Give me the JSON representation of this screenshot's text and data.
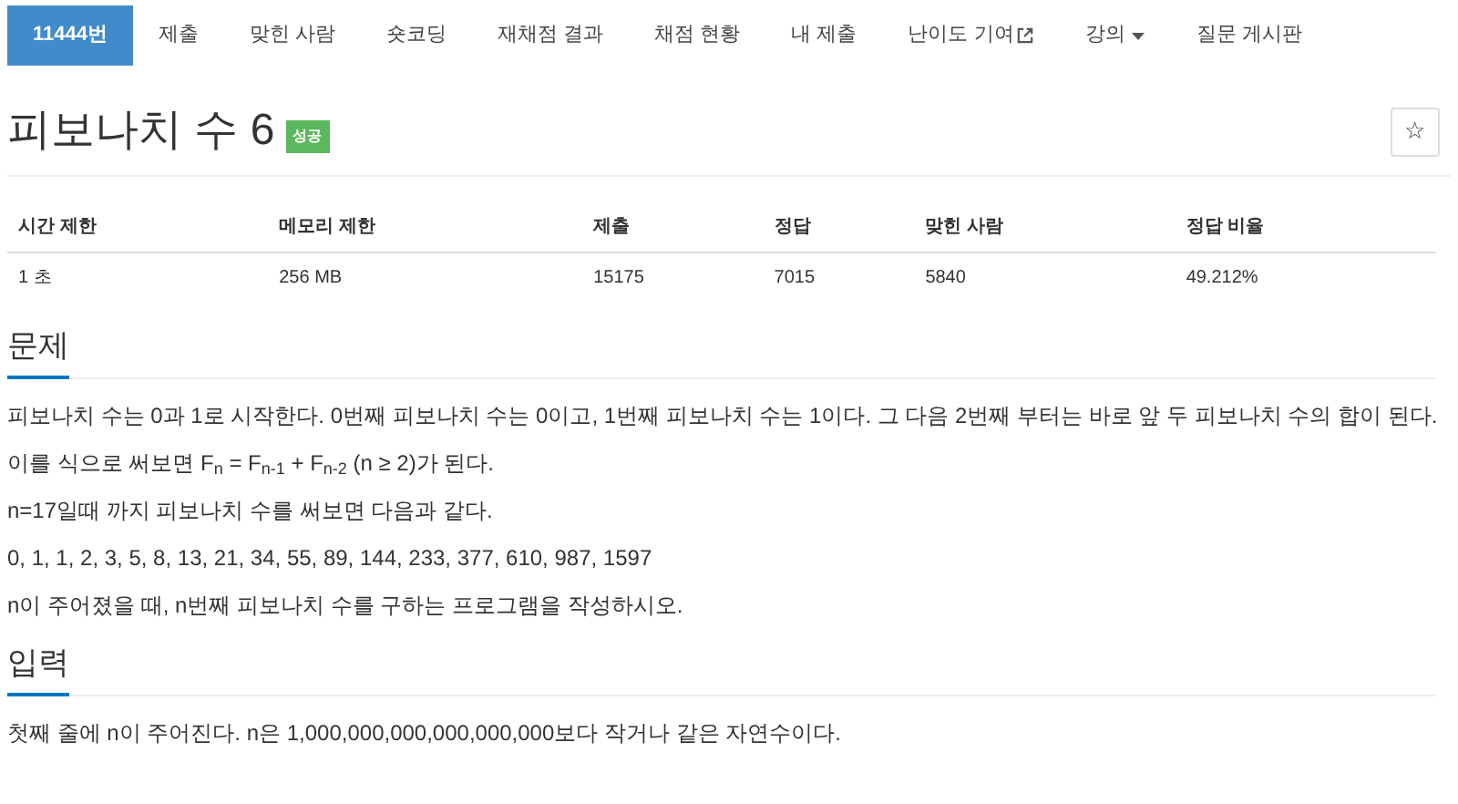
{
  "nav": [
    {
      "label": "11444번",
      "selected": true,
      "kind": "link"
    },
    {
      "label": "제출",
      "selected": false,
      "kind": "link"
    },
    {
      "label": "맞힌 사람",
      "selected": false,
      "kind": "link"
    },
    {
      "label": "숏코딩",
      "selected": false,
      "kind": "link"
    },
    {
      "label": "재채점 결과",
      "selected": false,
      "kind": "link"
    },
    {
      "label": "채점 현황",
      "selected": false,
      "kind": "link"
    },
    {
      "label": "내 제출",
      "selected": false,
      "kind": "link"
    },
    {
      "label": "난이도 기여",
      "selected": false,
      "kind": "external"
    },
    {
      "label": "강의",
      "selected": false,
      "kind": "dropdown"
    },
    {
      "label": "질문 게시판",
      "selected": false,
      "kind": "link"
    }
  ],
  "title": "피보나치 수 6",
  "badge": "성공",
  "star_button": "☆",
  "table": {
    "columns": [
      "시간 제한",
      "메모리 제한",
      "제출",
      "정답",
      "맞힌 사람",
      "정답 비율"
    ],
    "rows": [
      [
        "1 초",
        "256 MB",
        "15175",
        "7015",
        "5840",
        "49.212%"
      ]
    ]
  },
  "sections": [
    {
      "heading": "문제",
      "paragraphs": [
        "피보나치 수는 0과 1로 시작한다. 0번째 피보나치 수는 0이고, 1번째 피보나치 수는 1이다. 그 다음 2번째 부터는 바로 앞 두 피보나치 수의 합이 된다.",
        "이를 식으로 써보면 F$_{n}$ = F$_{n-1}$ + F$_{n-2}$ (n ≥ 2)가 된다.",
        "n=17일때 까지 피보나치 수를 써보면 다음과 같다.",
        "0, 1, 1, 2, 3, 5, 8, 13, 21, 34, 55, 89, 144, 233, 377, 610, 987, 1597",
        "n이 주어졌을 때, n번째 피보나치 수를 구하는 프로그램을 작성하시오."
      ]
    },
    {
      "heading": "입력",
      "paragraphs": [
        "첫째 줄에 n이 주어진다. n은 1,000,000,000,000,000,000보다 작거나 같은 자연수이다."
      ]
    }
  ]
}
